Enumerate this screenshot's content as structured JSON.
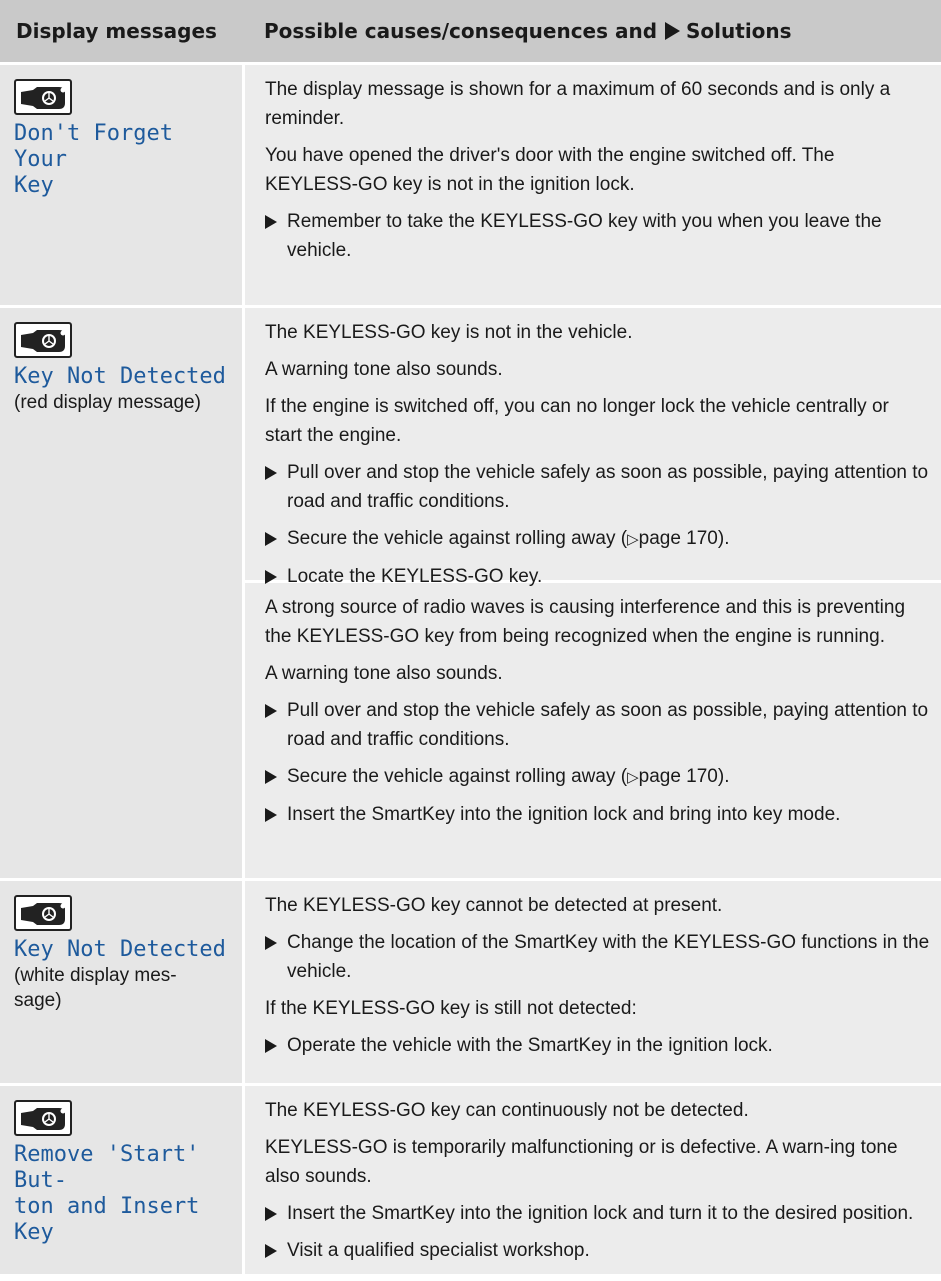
{
  "header": {
    "col1": "Display messages",
    "col2": "Possible causes/consequences and",
    "col2_solutions": "Solutions"
  },
  "icons": {
    "key": "smartkey-icon",
    "step": "triangle-right-icon"
  },
  "colors": {
    "message_text": "#1e5a9c",
    "header_bg": "#c9c9c9",
    "row_bg": "#ececec"
  },
  "rows": [
    {
      "message": "Don't Forget Your Key",
      "msg_line1": "Don't Forget Your",
      "msg_line2": "Key",
      "p1": "The display message is shown for a maximum of 60 seconds and is only a reminder.",
      "p2": "You have opened the driver's door with the engine switched off. The KEYLESS-GO key is not in the ignition lock.",
      "s1": "Remember to take the KEYLESS-GO key with you when you leave the vehicle."
    },
    {
      "message": "Key Not Detected",
      "note": "(red display message)",
      "a": {
        "p1": "The KEYLESS-GO key is not in the vehicle.",
        "p2": "A warning tone also sounds.",
        "p3": "If the engine is switched off, you can no longer lock the vehicle centrally or start the engine.",
        "s1": "Pull over and stop the vehicle safely as soon as possible, paying attention to road and traffic conditions.",
        "s2": "Secure the vehicle against rolling away (",
        "s2_ref": "page 170",
        "s2_end": ").",
        "s3": "Locate the KEYLESS-GO key."
      },
      "b": {
        "p1": "A strong source of radio waves is causing interference and this is preventing the KEYLESS-GO key from being recognized when the engine is running.",
        "p2": "A warning tone also sounds.",
        "s1": "Pull over and stop the vehicle safely as soon as possible, paying attention to road and traffic conditions.",
        "s2": "Secure the vehicle against rolling away (",
        "s2_ref": "page 170",
        "s2_end": ").",
        "s3": "Insert the SmartKey into the ignition lock and bring into key mode."
      }
    },
    {
      "message": "Key Not Detected",
      "note_line1": "(white display mes-",
      "note_line2": "sage)",
      "p1": "The KEYLESS-GO key cannot be detected at present.",
      "s1": "Change the location of the SmartKey with the KEYLESS-GO functions in the vehicle.",
      "p2": "If the KEYLESS-GO key is still not detected:",
      "s2": "Operate the vehicle with the SmartKey in the ignition lock."
    },
    {
      "msg_line1": "Remove 'Start' But-",
      "msg_line2": "ton and Insert Key",
      "p1": "The KEYLESS-GO key can continuously not be detected.",
      "p2": "KEYLESS-GO is temporarily malfunctioning or is defective. A warn-ing tone also sounds.",
      "s1": "Insert the SmartKey into the ignition lock and turn it to the desired position.",
      "s2": "Visit a qualified specialist workshop."
    }
  ]
}
